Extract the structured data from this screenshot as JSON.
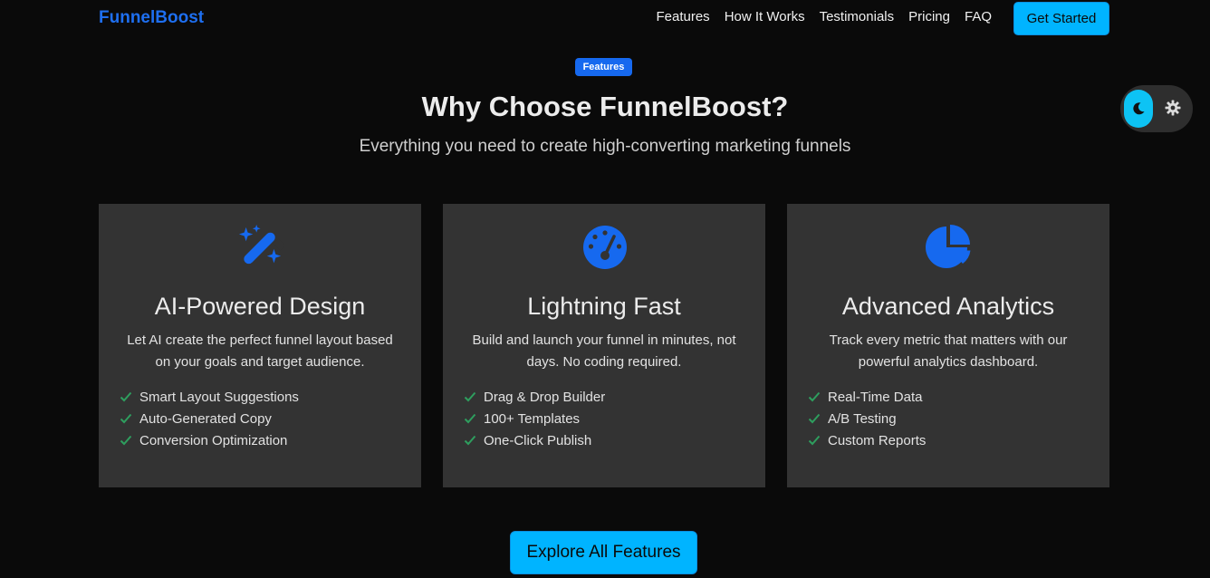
{
  "nav": {
    "brand": "FunnelBoost",
    "links": [
      "Features",
      "How It Works",
      "Testimonials",
      "Pricing",
      "FAQ"
    ],
    "cta": "Get Started"
  },
  "theme_toggle": {
    "active": "moon-icon",
    "inactive": "gear-icon"
  },
  "header": {
    "badge": "Features",
    "title": "Why Choose FunnelBoost?",
    "subtitle": "Everything you need to create high-converting marketing funnels"
  },
  "cards": [
    {
      "icon": "magic-wand-icon",
      "title": "AI-Powered Design",
      "description": "Let AI create the perfect funnel layout based on your goals and target audience.",
      "features": [
        "Smart Layout Suggestions",
        "Auto-Generated Copy",
        "Conversion Optimization"
      ]
    },
    {
      "icon": "speedometer-icon",
      "title": "Lightning Fast",
      "description": "Build and launch your funnel in minutes, not days. No coding required.",
      "features": [
        "Drag & Drop Builder",
        "100+ Templates",
        "One-Click Publish"
      ]
    },
    {
      "icon": "pie-chart-icon",
      "title": "Advanced Analytics",
      "description": "Track every metric that matters with our powerful analytics dashboard.",
      "features": [
        "Real-Time Data",
        "A/B Testing",
        "Custom Reports"
      ]
    }
  ],
  "explore_button": "Explore All Features",
  "colors": {
    "accent": "#00b4ff",
    "brand": "#1e6ff0",
    "icon": "#1669ef",
    "check": "#2e9e5e",
    "card_bg": "#333333",
    "page_bg": "#0a0a0a"
  }
}
